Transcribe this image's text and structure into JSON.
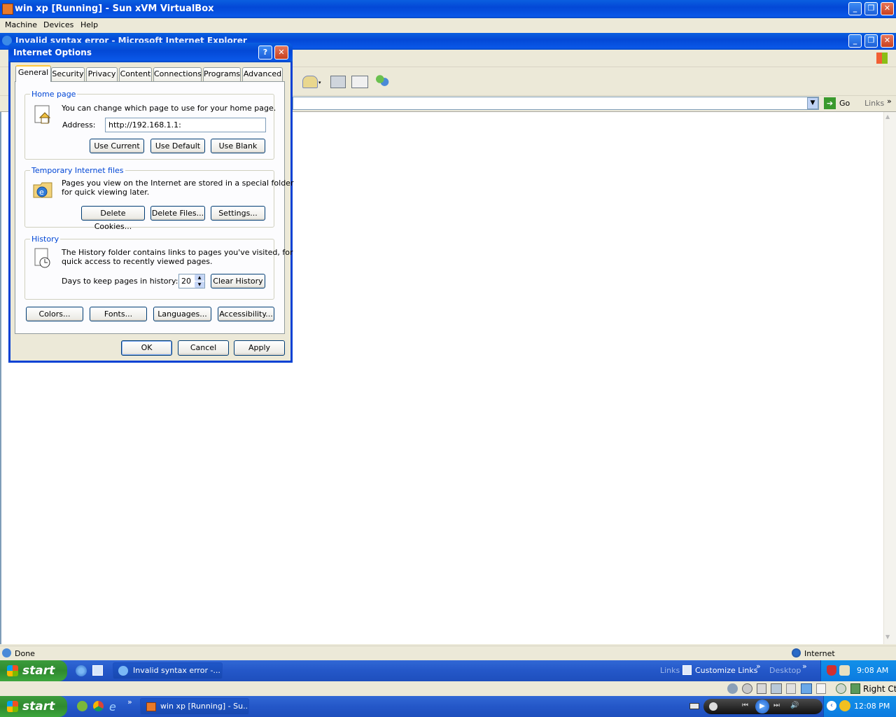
{
  "vbox": {
    "title": "win xp [Running] - Sun xVM VirtualBox",
    "menu": [
      "Machine",
      "Devices",
      "Help"
    ]
  },
  "ie": {
    "title": "Invalid syntax error - Microsoft Internet Explorer",
    "go_label": "Go",
    "links_label": "Links",
    "status_text": "Done",
    "zone_text": "Internet"
  },
  "dialog": {
    "title": "Internet Options",
    "tabs": [
      "General",
      "Security",
      "Privacy",
      "Content",
      "Connections",
      "Programs",
      "Advanced"
    ],
    "home": {
      "label": "Home page",
      "desc": "You can change which page to use for your home page.",
      "address_label": "Address:",
      "address_value": "http://192.168.1.1:",
      "buttons": [
        "Use Current",
        "Use Default",
        "Use Blank"
      ]
    },
    "temp": {
      "label": "Temporary Internet files",
      "desc1": "Pages you view on the Internet are stored in a special folder",
      "desc2": "for quick viewing later.",
      "buttons": [
        "Delete Cookies...",
        "Delete Files...",
        "Settings..."
      ]
    },
    "history": {
      "label": "History",
      "desc1": "The History folder contains links to pages you've visited, for",
      "desc2": "quick access to recently viewed pages.",
      "days_label": "Days to keep pages in history:",
      "days_value": "20",
      "clear_button": "Clear History"
    },
    "bottom_buttons": [
      "Colors...",
      "Fonts...",
      "Languages...",
      "Accessibility..."
    ],
    "ok": "OK",
    "cancel": "Cancel",
    "apply": "Apply"
  },
  "guest_taskbar": {
    "start": "start",
    "task": "Invalid syntax error -...",
    "links": "Links",
    "customize_links": "Customize Links",
    "desktop": "Desktop",
    "time": "9:08 AM"
  },
  "vbox_status": {
    "right_ctrl": "Right Ctrl"
  },
  "host_taskbar": {
    "start": "start",
    "task": "win xp [Running] - Su...",
    "time": "12:08 PM"
  }
}
